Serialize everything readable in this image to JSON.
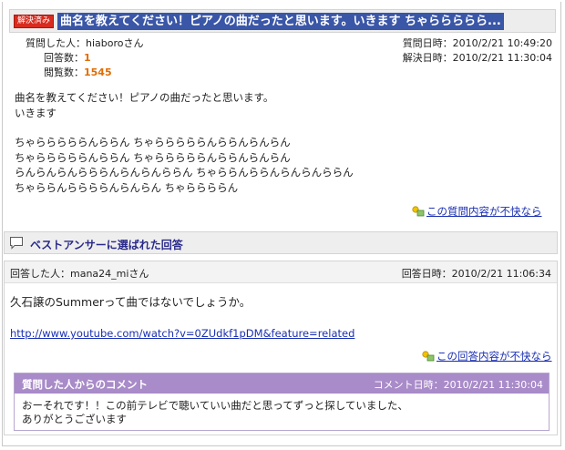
{
  "question": {
    "badge": "解決済み",
    "title": "曲名を教えてください！ピアノの曲だったと思います。いきます ちゃららららら...",
    "asker_label": "質問した人：",
    "asker_name": "hiaboroさん",
    "answers_label": "回答数：",
    "answers_count": "1",
    "views_label": "閲覧数：",
    "views_count": "1545",
    "asked_time": "質問日時：2010/2/21 10:49:20",
    "resolved_time": "解決日時：2010/2/21 11:30:04",
    "body_lines": [
      "曲名を教えてください！ピアノの曲だったと思います。",
      "いきます"
    ],
    "melody_lines": [
      "ちゃらららららんららん ちゃらららららんららんらんらん",
      "ちゃらららららんららん ちゃらららららんららんらんらん",
      "らんらんらんらららんらんらんららん ちゃららんららんらんらんららん",
      "ちゃららんららららんらんらん ちゃららららん"
    ],
    "report_link": "この質問内容が不快なら"
  },
  "best_answer": {
    "header": "ベストアンサーに選ばれた回答",
    "answerer": "回答した人：mana24_miさん",
    "answered_time": "回答日時：2010/2/21 11:06:34",
    "text": "久石譲のSummerって曲ではないでしょうか。",
    "url": "http://www.youtube.com/watch?v=0ZUdkf1pDM&feature=related",
    "report_link": "この回答内容が不快なら"
  },
  "comment": {
    "header": "質問した人からのコメント",
    "time": "コメント日時：2010/2/21 11:30:04",
    "lines": [
      "おーそれです！！この前テレビで聴いていい曲だと思ってずっと探していました、",
      "ありがとうございます"
    ]
  },
  "colors": {
    "title_bg": "#3a56a7",
    "badge_bg": "#d92b1f",
    "number": "#e06c00",
    "link": "#1a2fb2",
    "comment_header": "#a88bc8"
  },
  "icons": {
    "report": "report-flag-icon",
    "best_answer": "speech-bubble-icon"
  }
}
